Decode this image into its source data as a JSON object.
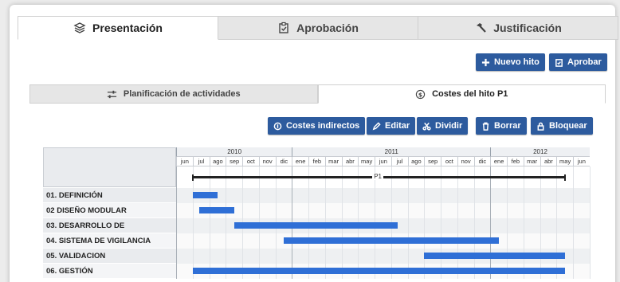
{
  "main_tabs": [
    {
      "label": "Presentación",
      "icon": "layers-icon",
      "active": true
    },
    {
      "label": "Aprobación",
      "icon": "clipboard-check-icon",
      "active": false
    },
    {
      "label": "Justificación",
      "icon": "hammer-icon",
      "active": false
    }
  ],
  "top_buttons": {
    "nuevo_hito": "Nuevo hito",
    "aprobar": "Aprobar"
  },
  "sub_tabs": [
    {
      "label": "Planificación de actividades",
      "icon": "sliders-icon",
      "active": false
    },
    {
      "label": "Costes del hito P1",
      "icon": "coin-icon",
      "active": true
    }
  ],
  "action_buttons": {
    "costes_indirectos": "Costes indirectos",
    "editar": "Editar",
    "dividir": "Dividir",
    "borrar": "Borrar",
    "bloquear": "Bloquear"
  },
  "gantt": {
    "years": [
      {
        "label": "2010",
        "start": 0,
        "span": 7
      },
      {
        "label": "2011",
        "start": 7,
        "span": 12
      },
      {
        "label": "2012",
        "start": 19,
        "span": 6
      }
    ],
    "months": [
      "jun",
      "jul",
      "ago",
      "sep",
      "oct",
      "nov",
      "dic",
      "ene",
      "feb",
      "mar",
      "abr",
      "may",
      "jun",
      "jul",
      "ago",
      "sep",
      "oct",
      "nov",
      "dic",
      "ene",
      "feb",
      "mar",
      "abr",
      "may",
      "jun"
    ],
    "milestone": {
      "label": "P1",
      "start": 1,
      "end": 23.5
    },
    "tasks": [
      {
        "label": "01. DEFINICIÓN",
        "start": 1,
        "end": 2.5
      },
      {
        "label": "02 DISEÑO MODULAR",
        "start": 1.4,
        "end": 3.5
      },
      {
        "label": "03. DESARROLLO DE",
        "start": 3.5,
        "end": 13.4
      },
      {
        "label": "04. SISTEMA DE VIGILANCIA",
        "start": 6.5,
        "end": 19.5
      },
      {
        "label": "05. VALIDACION",
        "start": 15,
        "end": 23.5
      },
      {
        "label": "06. GESTIÓN",
        "start": 1,
        "end": 23.5
      }
    ]
  },
  "colors": {
    "accent": "#2d5b9e",
    "bar": "#2f6fd6"
  }
}
